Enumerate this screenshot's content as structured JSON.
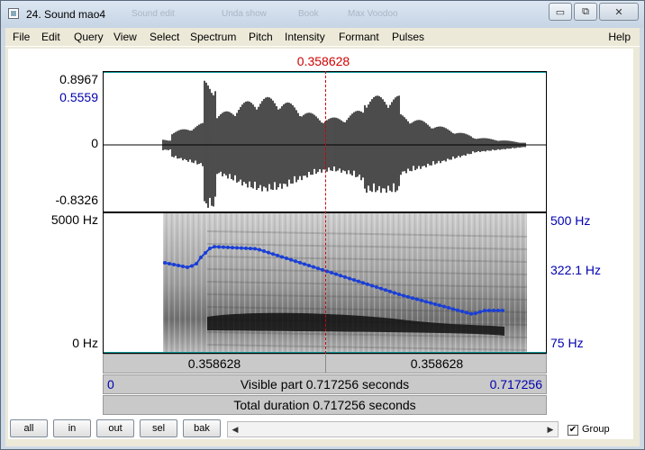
{
  "window": {
    "title": "24. Sound mao4",
    "ghost_tabs": [
      "Sound edit",
      "Unda show",
      "Book",
      "Max Voodoo"
    ],
    "min_label": "▭",
    "restore_label": "⧉",
    "close_label": "✕"
  },
  "menu": {
    "items": [
      "File",
      "Edit",
      "Query",
      "View",
      "Select",
      "Spectrum",
      "Pitch",
      "Intensity",
      "Formant",
      "Pulses"
    ],
    "help": "Help"
  },
  "editor": {
    "cursor_time": "0.358628",
    "wave_top": "0.8967",
    "wave_cursor_amp": "0.5559",
    "wave_zero": "0",
    "wave_bottom": "-0.8326",
    "spec_top": "5000 Hz",
    "spec_bottom": "0 Hz",
    "pitch_top": "500 Hz",
    "pitch_cursor": "322.1 Hz",
    "pitch_bottom": "75 Hz",
    "left_segment": "0.358628",
    "right_segment": "0.358628",
    "visible_start": "0",
    "visible_text": "Visible part 0.717256 seconds",
    "visible_end": "0.717256",
    "total_text": "Total duration 0.717256 seconds"
  },
  "buttons": {
    "all": "all",
    "in": "in",
    "out": "out",
    "sel": "sel",
    "bak": "bak",
    "group_label": "Group",
    "group_checked": true
  },
  "colors": {
    "cursor": "#d00000",
    "pitch": "#1a3fd6",
    "axis_blue": "#0000b0"
  }
}
